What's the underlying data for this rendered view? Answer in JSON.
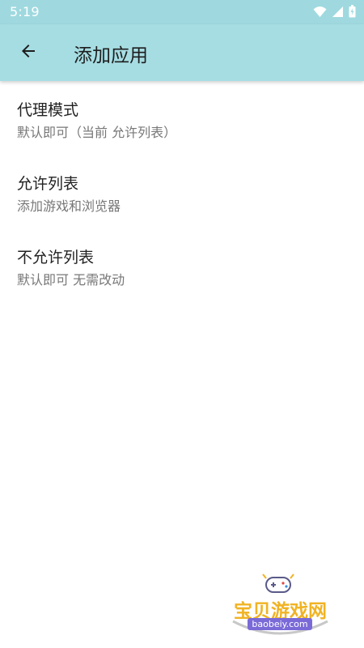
{
  "status_bar": {
    "time": "5:19",
    "icons": [
      "wifi-icon",
      "cell-signal-icon",
      "battery-icon"
    ]
  },
  "app_bar": {
    "title": "添加应用",
    "back_icon": "arrow-left-icon"
  },
  "settings": [
    {
      "title": "代理模式",
      "summary": "默认即可（当前 允许列表）"
    },
    {
      "title": "允许列表",
      "summary": "添加游戏和浏览器"
    },
    {
      "title": "不允许列表",
      "summary": "默认即可 无需改动"
    }
  ],
  "watermark": {
    "text": "宝贝游戏网",
    "url": "baobeiy.com"
  },
  "colors": {
    "app_bar": "#a6dde3",
    "status_bar": "#9fd9df",
    "title_text": "#222222",
    "summary_text": "#777777",
    "watermark_text": "#f0b323",
    "watermark_url_bg": "#7a6ad8"
  }
}
